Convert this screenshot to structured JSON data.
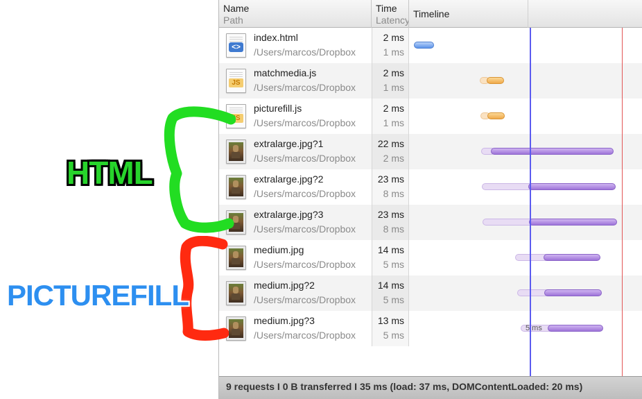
{
  "header": {
    "name_title": "Name",
    "name_sub": "Path",
    "time_title": "Time",
    "time_sub": "Latency",
    "timeline_title": "Timeline"
  },
  "rows": [
    {
      "name": "index.html",
      "path": "/Users/marcos/Dropbox",
      "time": "2 ms",
      "latency": "1 ms",
      "icon": "html-file-icon"
    },
    {
      "name": "matchmedia.js",
      "path": "/Users/marcos/Dropbox",
      "time": "2 ms",
      "latency": "1 ms",
      "icon": "js-file-icon"
    },
    {
      "name": "picturefill.js",
      "path": "/Users/marcos/Dropbox",
      "time": "2 ms",
      "latency": "1 ms",
      "icon": "js-file-icon"
    },
    {
      "name": "extralarge.jpg?1",
      "path": "/Users/marcos/Dropbox",
      "time": "22 ms",
      "latency": "2 ms",
      "icon": "image-file-icon"
    },
    {
      "name": "extralarge.jpg?2",
      "path": "/Users/marcos/Dropbox",
      "time": "23 ms",
      "latency": "8 ms",
      "icon": "image-file-icon"
    },
    {
      "name": "extralarge.jpg?3",
      "path": "/Users/marcos/Dropbox",
      "time": "23 ms",
      "latency": "8 ms",
      "icon": "image-file-icon"
    },
    {
      "name": "medium.jpg",
      "path": "/Users/marcos/Dropbox",
      "time": "14 ms",
      "latency": "5 ms",
      "icon": "image-file-icon"
    },
    {
      "name": "medium.jpg?2",
      "path": "/Users/marcos/Dropbox",
      "time": "14 ms",
      "latency": "5 ms",
      "icon": "image-file-icon"
    },
    {
      "name": "medium.jpg?3",
      "path": "/Users/marcos/Dropbox",
      "time": "13 ms",
      "latency": "5 ms",
      "icon": "image-file-icon"
    }
  ],
  "bar_label": "5 ms",
  "footer": {
    "summary": "9 requests  I  0 B transferred  I  35 ms (load: 37 ms, DOMContentLoaded: 20 ms)"
  },
  "annotations": {
    "html_label": "HTML",
    "picturefill_label": "PICTUREFILL",
    "html_color": "#27d42b",
    "picturefill_color": "#2d8ff0",
    "bracket_green": "#22dd22",
    "bracket_red": "#ff2a10"
  },
  "colors": {
    "dom_content_loaded_line": "#5b5bf0",
    "load_line": "#e25555",
    "image_bar": "#9e74d8",
    "script_bar": "#f0a94a",
    "html_bar": "#5c93ea"
  }
}
